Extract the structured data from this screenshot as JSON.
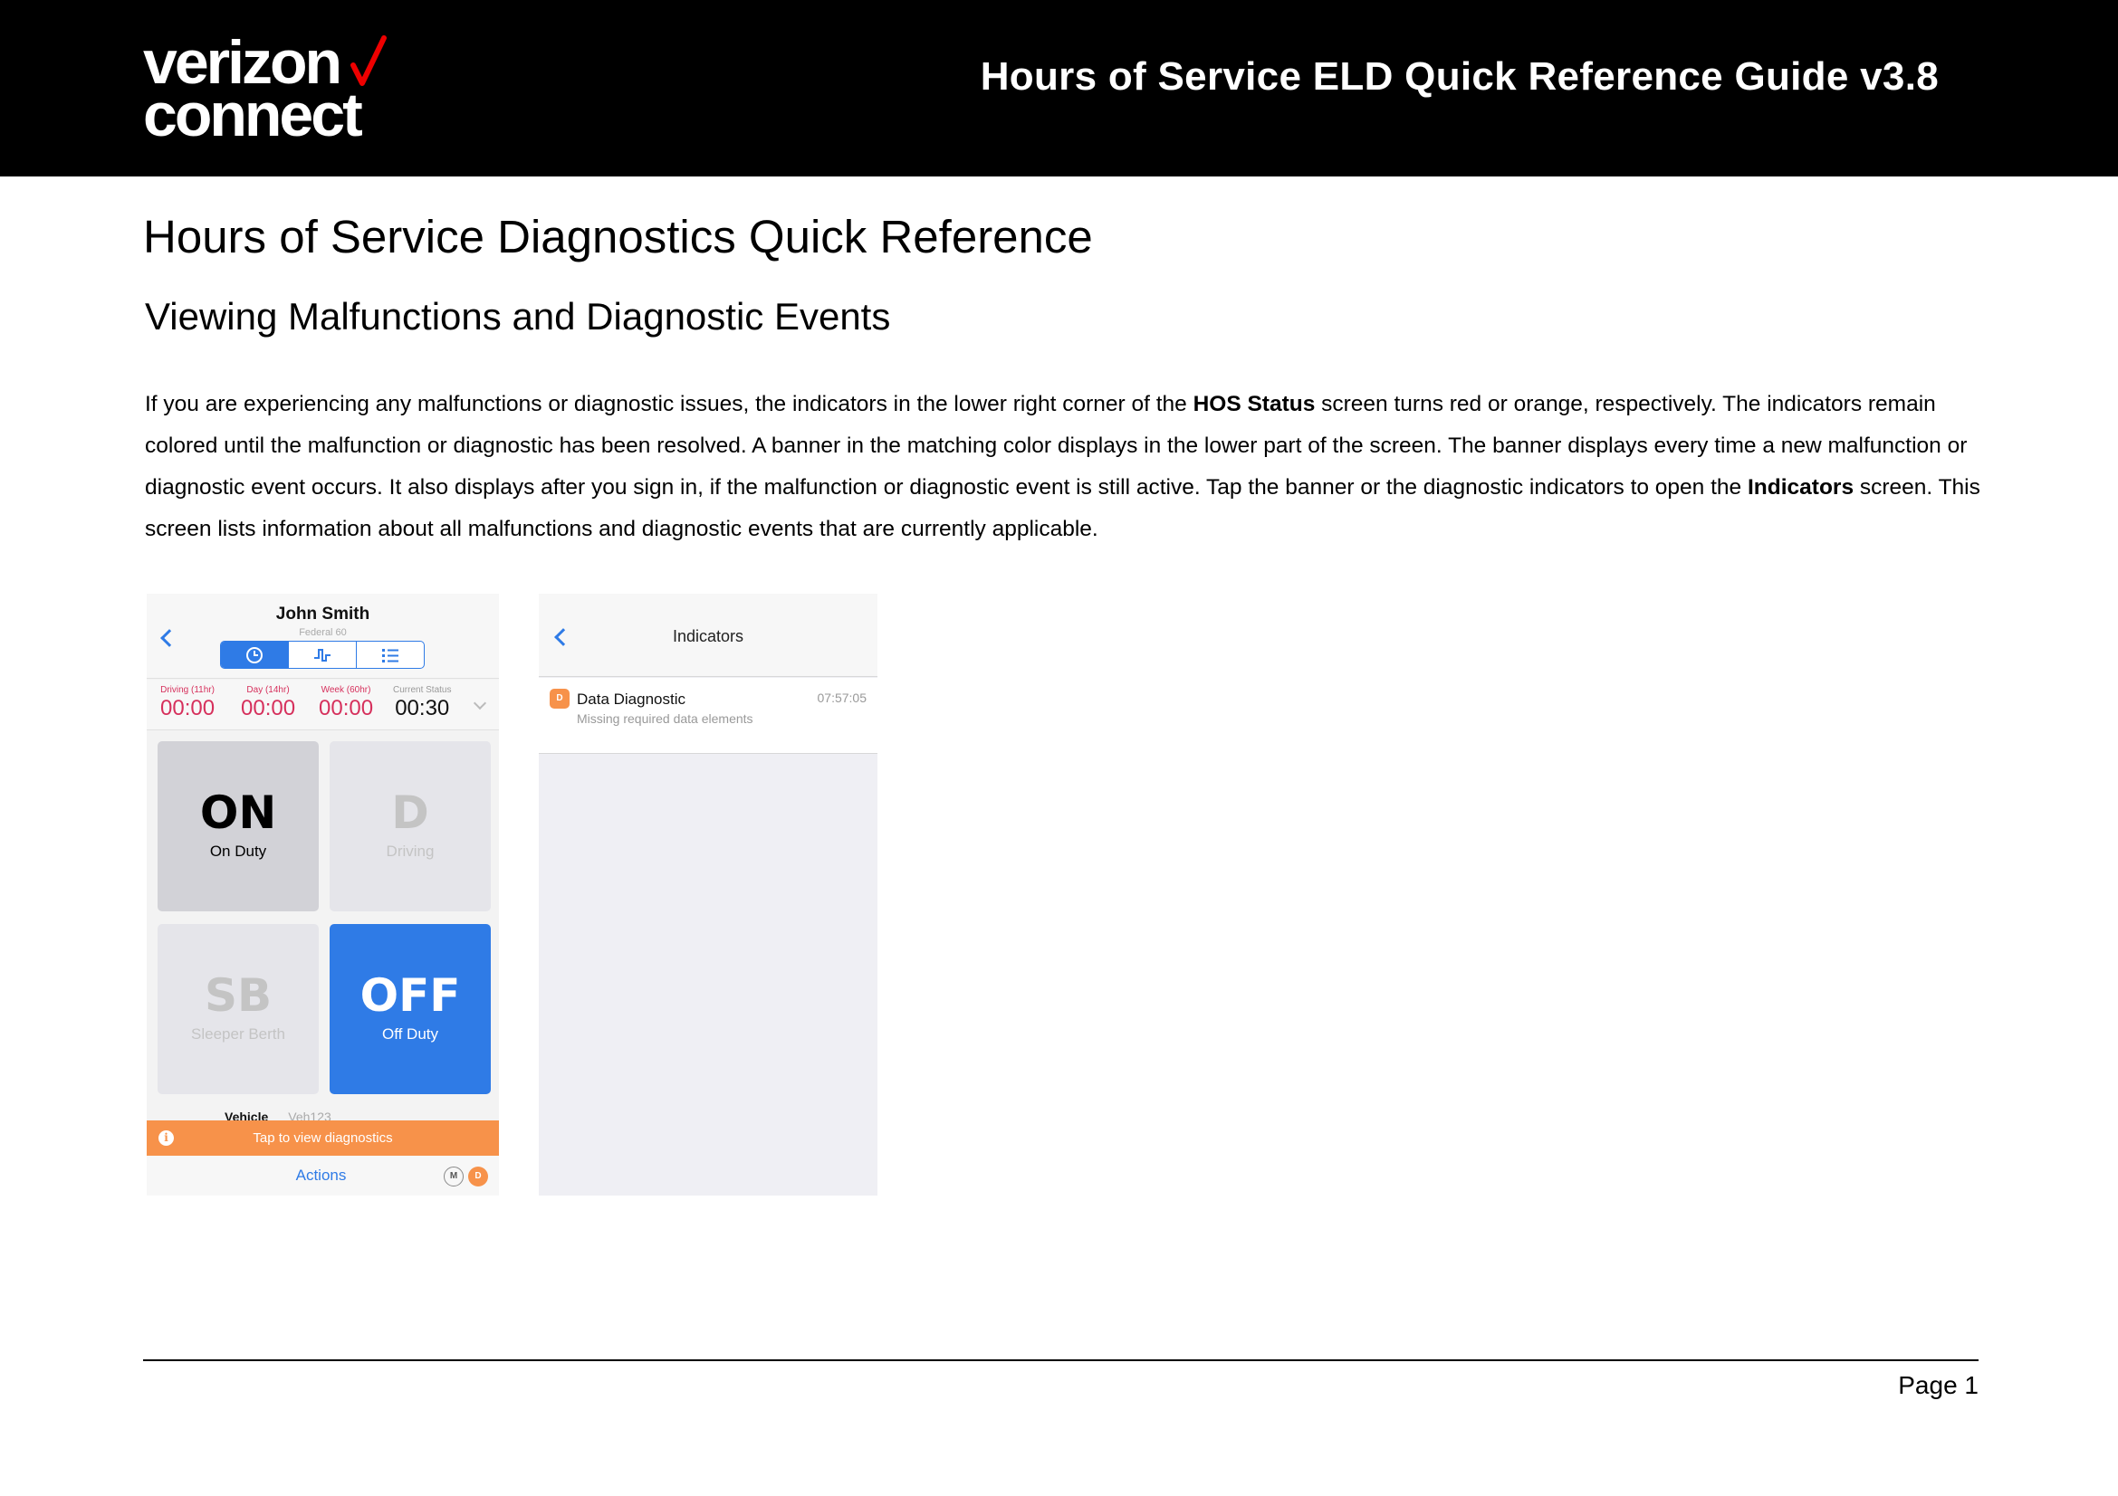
{
  "header": {
    "logo_line1": "verizon",
    "logo_line2": "connect",
    "guide_title": "Hours of Service ELD Quick Reference Guide v3.8",
    "colors": {
      "bar": "#000000",
      "check": "#ee0000"
    }
  },
  "heading1": "Hours of Service Diagnostics Quick Reference",
  "heading2": "Viewing Malfunctions and Diagnostic Events",
  "paragraph": {
    "p1": "If you are experiencing any malfunctions or diagnostic issues, the indicators in the lower right corner of the ",
    "b1": "HOS Status",
    "p2": " screen turns red or orange, respectively. The indicators remain colored until the malfunction or diagnostic has been resolved. A banner in the matching color displays in the lower part of the screen. The banner displays every time a new malfunction or diagnostic event occurs. It also displays after you sign in, if the malfunction or diagnostic event is still active. Tap the banner or the diagnostic indicators to open the ",
    "b2": "Indicators",
    "p3": " screen. This screen lists information about all malfunctions and diagnostic events that are currently applicable."
  },
  "status_screen": {
    "driver_name": "John Smith",
    "ruleset": "Federal 60",
    "tabs": [
      "clock-icon",
      "chart-icon",
      "list-icon"
    ],
    "timers": [
      {
        "label": "Driving (11hr)",
        "value": "00:00"
      },
      {
        "label": "Day (14hr)",
        "value": "00:00"
      },
      {
        "label": "Week (60hr)",
        "value": "00:00"
      },
      {
        "label": "Current Status",
        "value": "00:30"
      }
    ],
    "tiles": {
      "on": {
        "code": "ON",
        "label": "On Duty"
      },
      "d": {
        "code": "D",
        "label": "Driving"
      },
      "sb": {
        "code": "SB",
        "label": "Sleeper Berth"
      },
      "off": {
        "code": "OFF",
        "label": "Off Duty"
      }
    },
    "vehicle_label": "Vehicle",
    "vehicle_value": "Veh123",
    "banner_icon": "i",
    "banner_text": "Tap to view diagnostics",
    "actions_label": "Actions",
    "indicator_m": "M",
    "indicator_d": "D",
    "colors": {
      "blue": "#2f7be6",
      "red": "#d6305c",
      "orange": "#f7924a"
    }
  },
  "indicators_screen": {
    "title": "Indicators",
    "item": {
      "badge": "D",
      "name": "Data Diagnostic",
      "time": "07:57:05",
      "description": "Missing required data elements"
    }
  },
  "footer": {
    "page": "Page 1"
  }
}
